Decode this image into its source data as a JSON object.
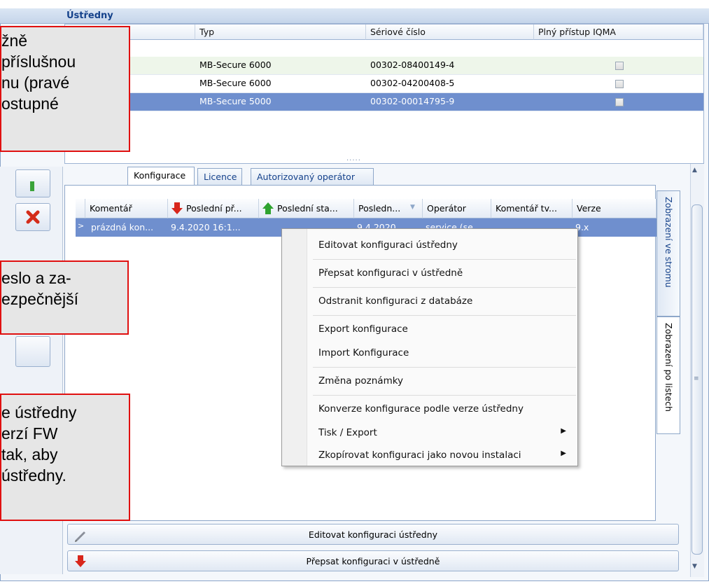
{
  "window": {
    "title": "Ústředny"
  },
  "top_grid": {
    "columns": [
      "Typ",
      "Sériové číslo",
      "Plný přístup IQMA"
    ],
    "rows": [
      {
        "typ": "MB-Secure 6000",
        "serial": "00302-08400149-4"
      },
      {
        "typ": "MB-Secure 6000",
        "serial": "00302-04200408-5"
      },
      {
        "typ": "MB-Secure 5000",
        "serial": "00302-00014795-9"
      }
    ],
    "splitter": "....."
  },
  "tabs": [
    "Konfigurace",
    "Licence",
    "Autorizovaný operátor"
  ],
  "config_grid": {
    "columns": [
      "Komentář",
      "Poslední př...",
      "Poslední sta...",
      "Posledn...",
      "Operátor",
      "Komentář tv...",
      "Verze"
    ],
    "row": {
      "komentar": "prázdná kon...",
      "posledni_pr": "9.4.2020 16:1...",
      "posledni_sta": "",
      "posledn": "9.4.2020",
      "operator": "service (se...",
      "komentar_tv": "",
      "verze": "9.x"
    }
  },
  "side_tabs": [
    "Zobrazení ve stromu",
    "Zobrazení po listech"
  ],
  "context_menu": {
    "items": [
      "Editovat konfiguraci ústředny",
      "Přepsat konfiguraci v ústředně",
      "Odstranit konfiguraci z databáze",
      "Export konfigurace",
      "Import Konfigurace",
      "Změna poznámky",
      "Konverze konfigurace podle verze ústředny",
      "Tisk / Export",
      "Zkopírovat konfiguraci jako novou instalaci"
    ]
  },
  "bottom_buttons": {
    "edit": "Editovat konfiguraci ústředny",
    "overwrite": "Přepsat konfiguraci v ústředně"
  },
  "callouts": {
    "c1": [
      "žně",
      "příslušnou",
      "nu (pravé",
      "ostupné"
    ],
    "c2": [
      "eslo a za-",
      "ezpečnější"
    ],
    "c3": [
      "e ústředny",
      "erzí FW",
      "tak, aby",
      "ústředny."
    ]
  },
  "colors": {
    "selection": "#6f8fce",
    "callout_border": "#e01010"
  }
}
